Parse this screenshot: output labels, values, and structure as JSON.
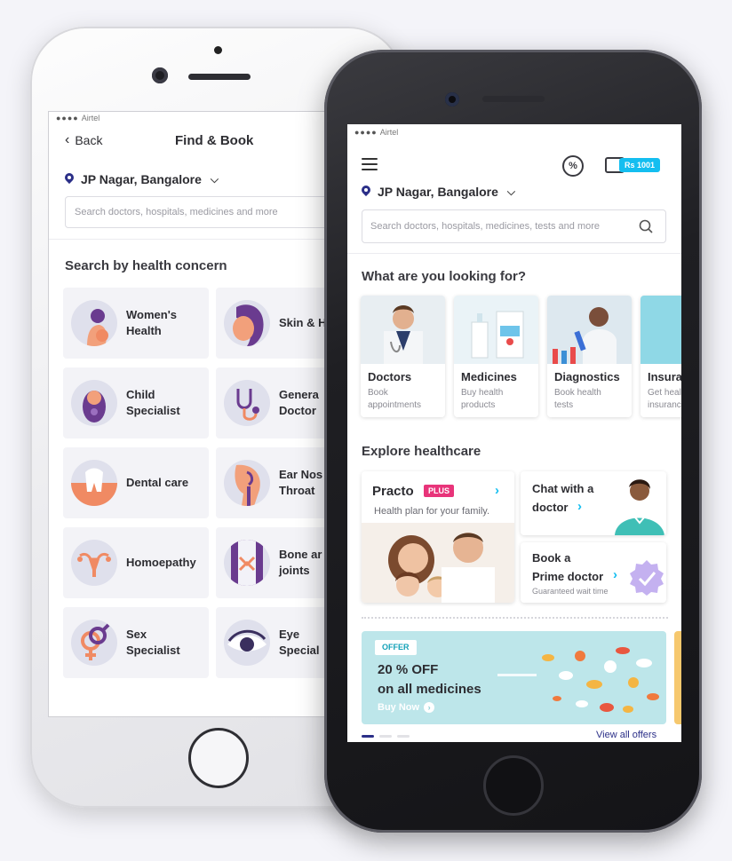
{
  "back_phone": {
    "status": {
      "dots": "●●●●",
      "carrier": "Airtel"
    },
    "header": {
      "back_label": "Back",
      "title": "Find & Book"
    },
    "location": "JP Nagar, Bangalore",
    "search_placeholder": "Search doctors, hospitals, medicines and more",
    "section_title": "Search by health concern",
    "concerns": [
      {
        "label": "Women's\nHealth",
        "icon": "pregnant-woman-icon"
      },
      {
        "label": "Skin & H",
        "icon": "skin-face-icon"
      },
      {
        "label": "Child\nSpecialist",
        "icon": "baby-icon"
      },
      {
        "label": "Genera\nDoctor",
        "icon": "stethoscope-icon"
      },
      {
        "label": "Dental care",
        "icon": "tooth-icon"
      },
      {
        "label": "Ear Nos\nThroat",
        "icon": "ear-nose-throat-icon"
      },
      {
        "label": "Homoepathy",
        "icon": "uterus-icon"
      },
      {
        "label": "Bone ar\njoints",
        "icon": "bone-joint-icon"
      },
      {
        "label": "Sex\nSpecialist",
        "icon": "gender-symbol-icon"
      },
      {
        "label": "Eye\nSpecial",
        "icon": "eye-icon"
      }
    ]
  },
  "front_phone": {
    "status": {
      "dots": "●●●●",
      "carrier": "Airtel"
    },
    "wallet_badge": "Rs 1001",
    "offers_icon_text": "%",
    "location": "JP Nagar, Bangalore",
    "search_placeholder": "Search doctors, hospitals, medicines, tests and more",
    "looking_title": "What are you looking for?",
    "categories": [
      {
        "name": "Doctors",
        "sub": "Book\nappointments"
      },
      {
        "name": "Medicines",
        "sub": "Buy health\nproducts"
      },
      {
        "name": "Diagnostics",
        "sub": "Book health\ntests"
      },
      {
        "name": "Insura",
        "sub": "Get heal\ninsuranc"
      }
    ],
    "explore_title": "Explore healthcare",
    "practo": {
      "name": "Practo",
      "badge": "PLUS",
      "tagline": "Health plan for your family."
    },
    "chat": {
      "line1": "Chat with a",
      "line2": "doctor"
    },
    "prime": {
      "line1": "Book a",
      "line2": "Prime doctor",
      "sub": "Guaranteed wait time"
    },
    "offer": {
      "badge": "OFFER",
      "line1": "20 % OFF",
      "line2": "on all medicines",
      "cta": "Buy Now"
    },
    "view_all": "View all offers"
  },
  "colors": {
    "brand_blue": "#14bef0",
    "navy": "#2b2f88",
    "plus_pink": "#e8347a"
  }
}
